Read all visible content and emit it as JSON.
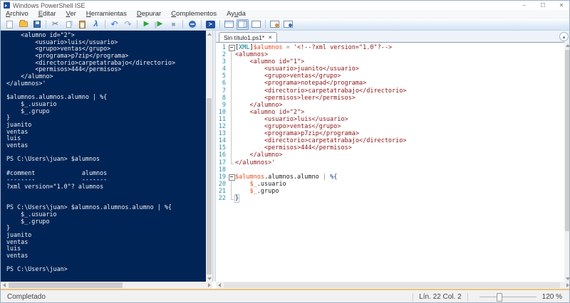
{
  "window": {
    "title": "Windows PowerShell ISE",
    "controls": {
      "minimize": "–",
      "maximize": "☐",
      "close": "✕"
    }
  },
  "menu": {
    "items": [
      {
        "label": "Archivo",
        "u": 0
      },
      {
        "label": "Editar",
        "u": 0
      },
      {
        "label": "Ver",
        "u": 0
      },
      {
        "label": "Herramientas",
        "u": 0
      },
      {
        "label": "Depurar",
        "u": 0
      },
      {
        "label": "Complementos",
        "u": 0
      },
      {
        "label": "Ayuda",
        "u": 2
      }
    ]
  },
  "toolbar": {
    "buttons": [
      {
        "name": "new-script-button",
        "icon": "new-file-icon",
        "kind": "new",
        "glyph": ""
      },
      {
        "name": "open-script-button",
        "icon": "open-folder-icon",
        "kind": "open",
        "glyph": ""
      },
      {
        "name": "save-button",
        "icon": "floppy-disk-icon",
        "kind": "save",
        "glyph": ""
      },
      {
        "kind": "sep"
      },
      {
        "name": "cut-button",
        "icon": "scissors-icon",
        "kind": "cut",
        "glyph": "✂"
      },
      {
        "name": "copy-button",
        "icon": "copy-icon",
        "kind": "copy",
        "glyph": ""
      },
      {
        "name": "paste-button",
        "icon": "clipboard-icon",
        "kind": "paste",
        "glyph": ""
      },
      {
        "name": "clear-console-button",
        "icon": "squeegee-icon",
        "kind": "clear",
        "glyph": "λ"
      },
      {
        "kind": "sep"
      },
      {
        "name": "undo-button",
        "icon": "undo-arrow-icon",
        "kind": "undo",
        "glyph": "↶"
      },
      {
        "name": "redo-button",
        "icon": "redo-arrow-icon",
        "kind": "redo",
        "glyph": "↷"
      },
      {
        "kind": "sep"
      },
      {
        "name": "run-script-button",
        "icon": "play-icon",
        "kind": "run",
        "glyph": "▶"
      },
      {
        "name": "run-selection-button",
        "icon": "play-selection-icon",
        "kind": "runsel",
        "glyph": "▶"
      },
      {
        "name": "stop-operation-button",
        "icon": "stop-square-icon",
        "kind": "stop",
        "glyph": "■"
      },
      {
        "kind": "sep"
      },
      {
        "name": "new-remote-powershell-tab-button",
        "icon": "remote-session-icon",
        "kind": "remote",
        "glyph": ""
      },
      {
        "kind": "sep"
      },
      {
        "name": "start-powershell-exe-button",
        "icon": "powershell-icon",
        "kind": "psexe",
        "glyph": "≻"
      },
      {
        "kind": "sep"
      },
      {
        "name": "show-script-pane-top-button",
        "icon": "layout-top-icon",
        "kind": "laytop",
        "glyph": ""
      },
      {
        "name": "show-script-pane-right-button",
        "icon": "layout-right-icon",
        "kind": "layright",
        "glyph": "",
        "selected": true
      },
      {
        "name": "show-script-pane-maximized-button",
        "icon": "layout-max-icon",
        "kind": "laymax",
        "glyph": ""
      },
      {
        "kind": "sep"
      },
      {
        "name": "script-pane-toggle-1-button",
        "icon": "window-orange-icon",
        "kind": "sp1",
        "glyph": ""
      },
      {
        "name": "script-pane-toggle-2-button",
        "icon": "window-blue-icon",
        "kind": "sp2",
        "glyph": ""
      }
    ]
  },
  "console": {
    "lines": [
      "    <alumno id=\"2\">",
      "        <usuario>luis</usuario>",
      "        <grupo>ventas</grupo>",
      "        <programa>p7zip</programa>",
      "        <directorio>carpetatrabajo</directorio>",
      "        <permisos>444</permisos>",
      "    </alumno>",
      "</alumnos>'",
      "",
      "$alumnos.alumnos.alumno | %{",
      "    $_.usuario",
      "    $_.grupo",
      "}",
      "juanito",
      "ventas",
      "luis",
      "ventas",
      "",
      "PS C:\\Users\\juan> $alumnos",
      "",
      "#comment             alumnos",
      "--------             -------",
      "?xml version=\"1.0\"? alumnos",
      "",
      "",
      "PS C:\\Users\\juan> $alumnos.alumnos.alumno | %{",
      "    $_.usuario",
      "    $_.grupo",
      "}",
      "juanito",
      "ventas",
      "luis",
      "ventas",
      "",
      "PS C:\\Users\\juan>"
    ]
  },
  "editor": {
    "tab": {
      "label": "Sin título1.ps1*",
      "close_glyph": "✕"
    },
    "collapse_glyph": "▴",
    "lines": [
      {
        "n": 1,
        "fold": "start",
        "segs": [
          [
            "p",
            "["
          ],
          [
            "type",
            "XML"
          ],
          [
            "p",
            "]"
          ],
          [
            "var",
            "$alumnos"
          ],
          [
            "op",
            " = "
          ],
          [
            "str",
            "'<!--?xml version=\"1.0\"?-->"
          ]
        ]
      },
      {
        "n": 2,
        "fold": "line",
        "segs": [
          [
            "str",
            "<alumnos>"
          ]
        ]
      },
      {
        "n": 3,
        "fold": "line",
        "segs": [
          [
            "str",
            "    <alumno id=\"1\">"
          ]
        ]
      },
      {
        "n": 4,
        "fold": "line",
        "segs": [
          [
            "str",
            "        <usuario>juanito</usuario>"
          ]
        ]
      },
      {
        "n": 5,
        "fold": "line",
        "segs": [
          [
            "str",
            "        <grupo>ventas</grupo>"
          ]
        ]
      },
      {
        "n": 6,
        "fold": "line",
        "segs": [
          [
            "str",
            "        <programa>notepad</programa>"
          ]
        ]
      },
      {
        "n": 7,
        "fold": "line",
        "segs": [
          [
            "str",
            "        <directorio>carpetatrabajo</directorio>"
          ]
        ]
      },
      {
        "n": 8,
        "fold": "line",
        "segs": [
          [
            "str",
            "        <permisos>leer</permisos>"
          ]
        ]
      },
      {
        "n": 9,
        "fold": "line",
        "segs": [
          [
            "str",
            "    </alumno>"
          ]
        ]
      },
      {
        "n": 10,
        "fold": "line",
        "segs": [
          [
            "str",
            "    <alumno id=\"2\">"
          ]
        ]
      },
      {
        "n": 11,
        "fold": "line",
        "segs": [
          [
            "str",
            "        <usuario>luis</usuario>"
          ]
        ]
      },
      {
        "n": 12,
        "fold": "line",
        "segs": [
          [
            "str",
            "        <grupo>ventas</grupo>"
          ]
        ]
      },
      {
        "n": 13,
        "fold": "line",
        "segs": [
          [
            "str",
            "        <programa>p7zip</programa>"
          ]
        ]
      },
      {
        "n": 14,
        "fold": "line",
        "segs": [
          [
            "str",
            "        <directorio>carpetatrabajo</directorio>"
          ]
        ]
      },
      {
        "n": 15,
        "fold": "line",
        "segs": [
          [
            "str",
            "        <permisos>444</permisos>"
          ]
        ]
      },
      {
        "n": 16,
        "fold": "line",
        "segs": [
          [
            "str",
            "    </alumno>"
          ]
        ]
      },
      {
        "n": 17,
        "fold": "end",
        "segs": [
          [
            "str",
            "</alumnos>'"
          ]
        ]
      },
      {
        "n": 18,
        "fold": "",
        "segs": []
      },
      {
        "n": 19,
        "fold": "start",
        "segs": [
          [
            "var",
            "$alumnos"
          ],
          [
            "p",
            ".alumnos.alumno "
          ],
          [
            "op",
            "| "
          ],
          [
            "kw",
            "%{"
          ]
        ]
      },
      {
        "n": 20,
        "fold": "line",
        "segs": [
          [
            "p",
            "    "
          ],
          [
            "var",
            "$_"
          ],
          [
            "p",
            ".usuario"
          ]
        ]
      },
      {
        "n": 21,
        "fold": "line",
        "segs": [
          [
            "p",
            "    "
          ],
          [
            "var",
            "$_"
          ],
          [
            "p",
            ".grupo"
          ]
        ]
      },
      {
        "n": 22,
        "fold": "end",
        "segs": [
          [
            "hl",
            "}"
          ]
        ]
      }
    ]
  },
  "statusbar": {
    "status": "Completado",
    "position": "Lín. 22 Col. 2",
    "zoom_level": "120 %"
  },
  "colors": {
    "console_background": "#012456",
    "console_text": "#efeef2",
    "string": "#8b1616",
    "variable": "#e8491c",
    "type": "#008080",
    "line_number": "#2b91af"
  }
}
